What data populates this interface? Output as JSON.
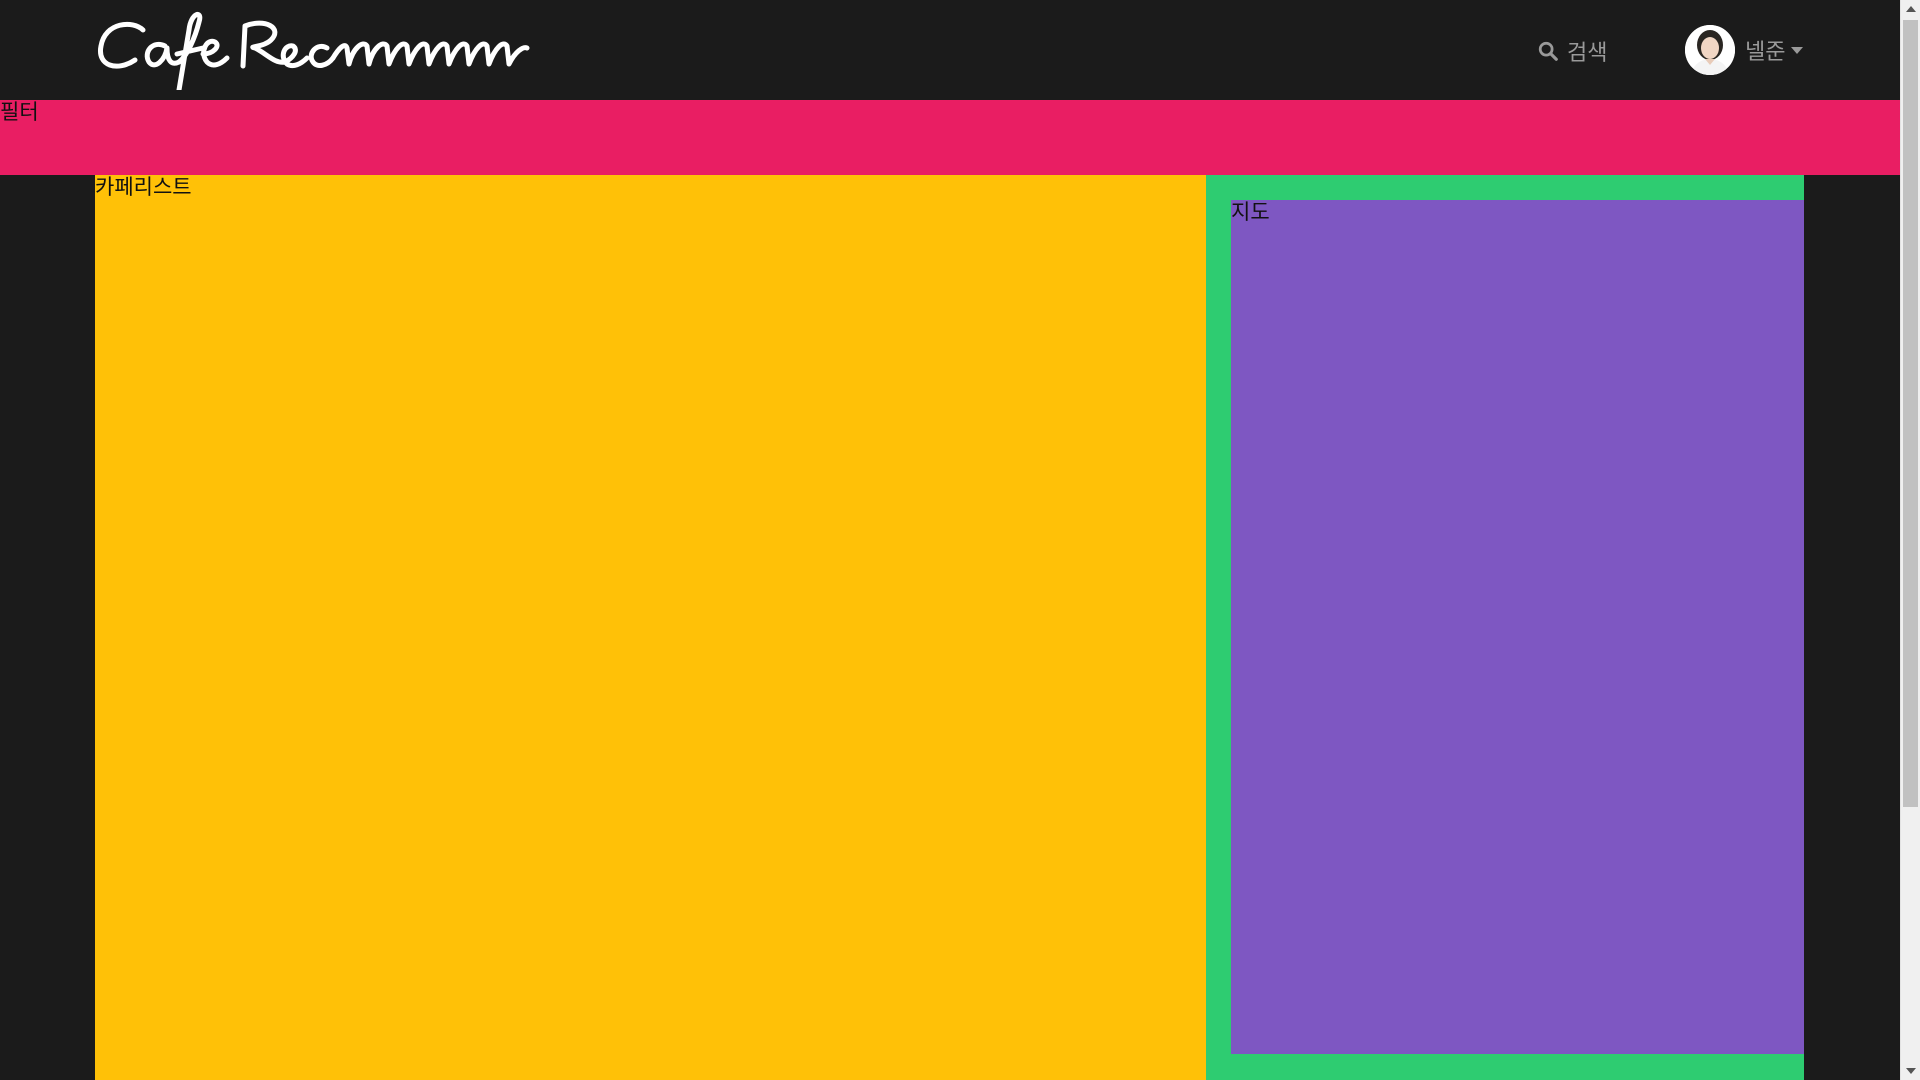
{
  "header": {
    "logo_text": "CafeRecommm",
    "search_label": "검색",
    "user": {
      "name": "넬준"
    }
  },
  "filter": {
    "label": "필터"
  },
  "cafe_list": {
    "label": "카페리스트"
  },
  "map": {
    "label": "지도"
  },
  "colors": {
    "background": "#1b1b1b",
    "filter_bar": "#e91e63",
    "cafe_list": "#ffc107",
    "map_border": "#2ecc71",
    "map": "#7e57c2",
    "nav_text": "#9a9a9a"
  },
  "scrollbar": {
    "position_fraction": 0
  }
}
